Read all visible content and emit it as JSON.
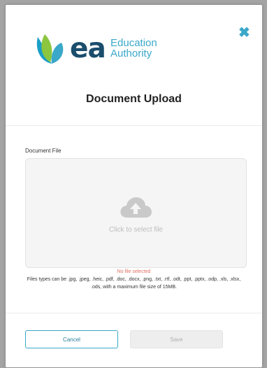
{
  "modal": {
    "close_symbol": "✖",
    "logo": {
      "mark": "ea",
      "org_line1": "Education",
      "org_line2": "Authority"
    },
    "title": "Document Upload",
    "field_label": "Document File",
    "dropzone": {
      "icon": "cloud-upload-icon",
      "text": "Click to select file"
    },
    "status": "No file selected",
    "file_types_text": "Files types can be .jpg, .jpeg, .heic, .pdf, .doc, .docx, .png, .txt, .rtf, .odt, .ppt, .pptx, .odp, .xls, .xlsx, .ods, with a maximum file size of 15MB.",
    "buttons": {
      "cancel": "Cancel",
      "save": "Save"
    }
  },
  "colors": {
    "accent": "#3aa8c9",
    "brand_dark": "#1b4d6d",
    "logo_green": "#8cc63f",
    "error": "#e07060"
  }
}
